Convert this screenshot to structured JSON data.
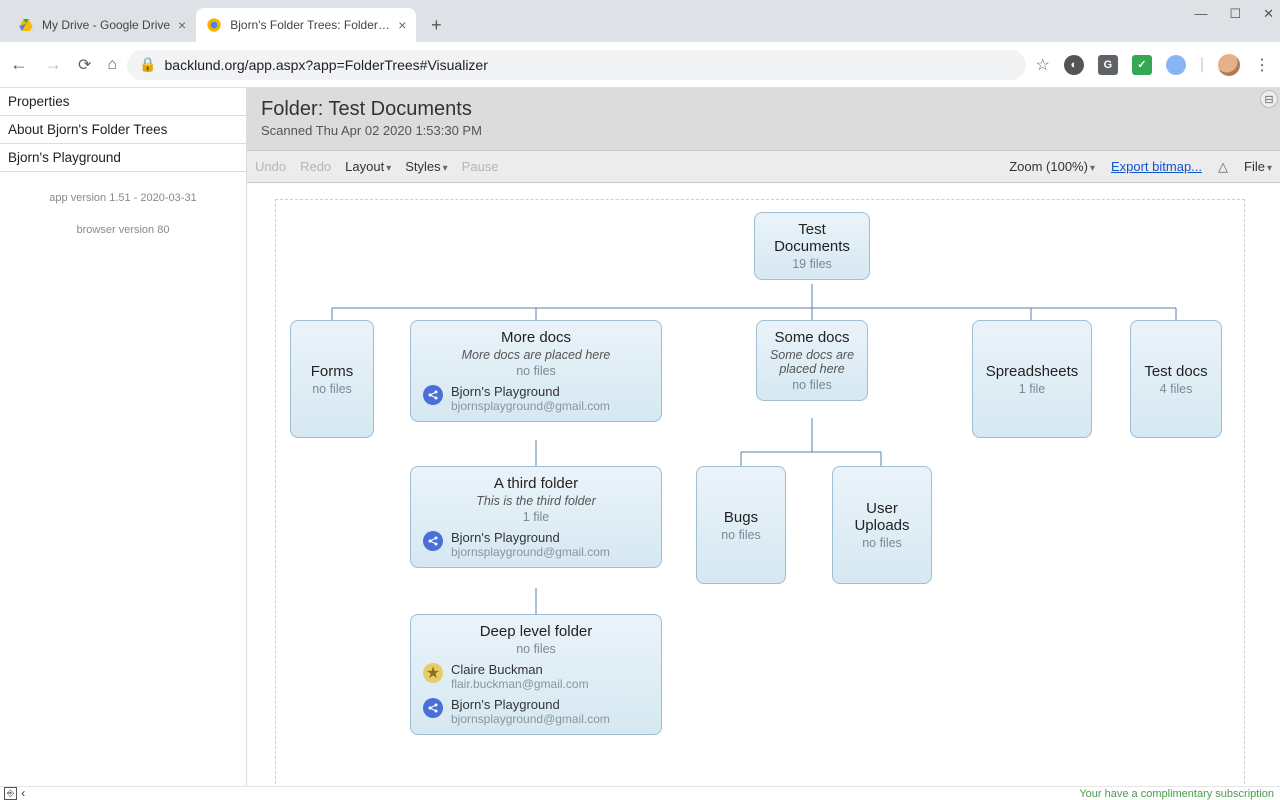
{
  "browser": {
    "tabs": [
      {
        "title": "My Drive - Google Drive",
        "active": false
      },
      {
        "title": "Bjorn's Folder Trees: Folder: Test",
        "active": true
      }
    ],
    "url": "backlund.org/app.aspx?app=FolderTrees#Visualizer",
    "window_controls": {
      "min": "—",
      "max": "☐",
      "close": "✕"
    }
  },
  "sidebar": {
    "items": [
      {
        "label": "Properties"
      },
      {
        "label": "About Bjorn's Folder Trees"
      },
      {
        "label": "Bjorn's Playground"
      }
    ],
    "app_version": "app version 1.51 - 2020-03-31",
    "browser_version": "browser version 80"
  },
  "header": {
    "title": "Folder: Test Documents",
    "subtitle": "Scanned Thu Apr 02 2020 1:53:30 PM"
  },
  "toolbar": {
    "undo": "Undo",
    "redo": "Redo",
    "layout": "Layout",
    "styles": "Styles",
    "pause": "Pause",
    "zoom": "Zoom (100%)",
    "export": "Export bitmap...",
    "file": "File"
  },
  "tree": {
    "root": {
      "title": "Test Documents",
      "files": "19 files"
    },
    "level1": {
      "forms": {
        "title": "Forms",
        "files": "no files"
      },
      "more": {
        "title": "More docs",
        "desc": "More docs are placed here",
        "files": "no files",
        "owner_name": "Bjorn's Playground",
        "owner_email": "bjornsplayground@gmail.com"
      },
      "some": {
        "title": "Some docs",
        "desc": "Some docs are placed here",
        "files": "no files"
      },
      "spread": {
        "title": "Spreadsheets",
        "files": "1 file"
      },
      "test": {
        "title": "Test docs",
        "files": "4 files"
      }
    },
    "level2": {
      "third": {
        "title": "A third folder",
        "desc": "This is the third folder",
        "files": "1 file",
        "owner_name": "Bjorn's Playground",
        "owner_email": "bjornsplayground@gmail.com"
      },
      "bugs": {
        "title": "Bugs",
        "files": "no files"
      },
      "uploads": {
        "title": "User Uploads",
        "files": "no files"
      }
    },
    "level3": {
      "deep": {
        "title": "Deep level folder",
        "files": "no files",
        "owner1_name": "Claire Buckman",
        "owner1_email": "flair.buckman@gmail.com",
        "owner2_name": "Bjorn's Playground",
        "owner2_email": "bjornsplayground@gmail.com"
      }
    }
  },
  "status": {
    "subscription": "Your have a complimentary subscription"
  }
}
